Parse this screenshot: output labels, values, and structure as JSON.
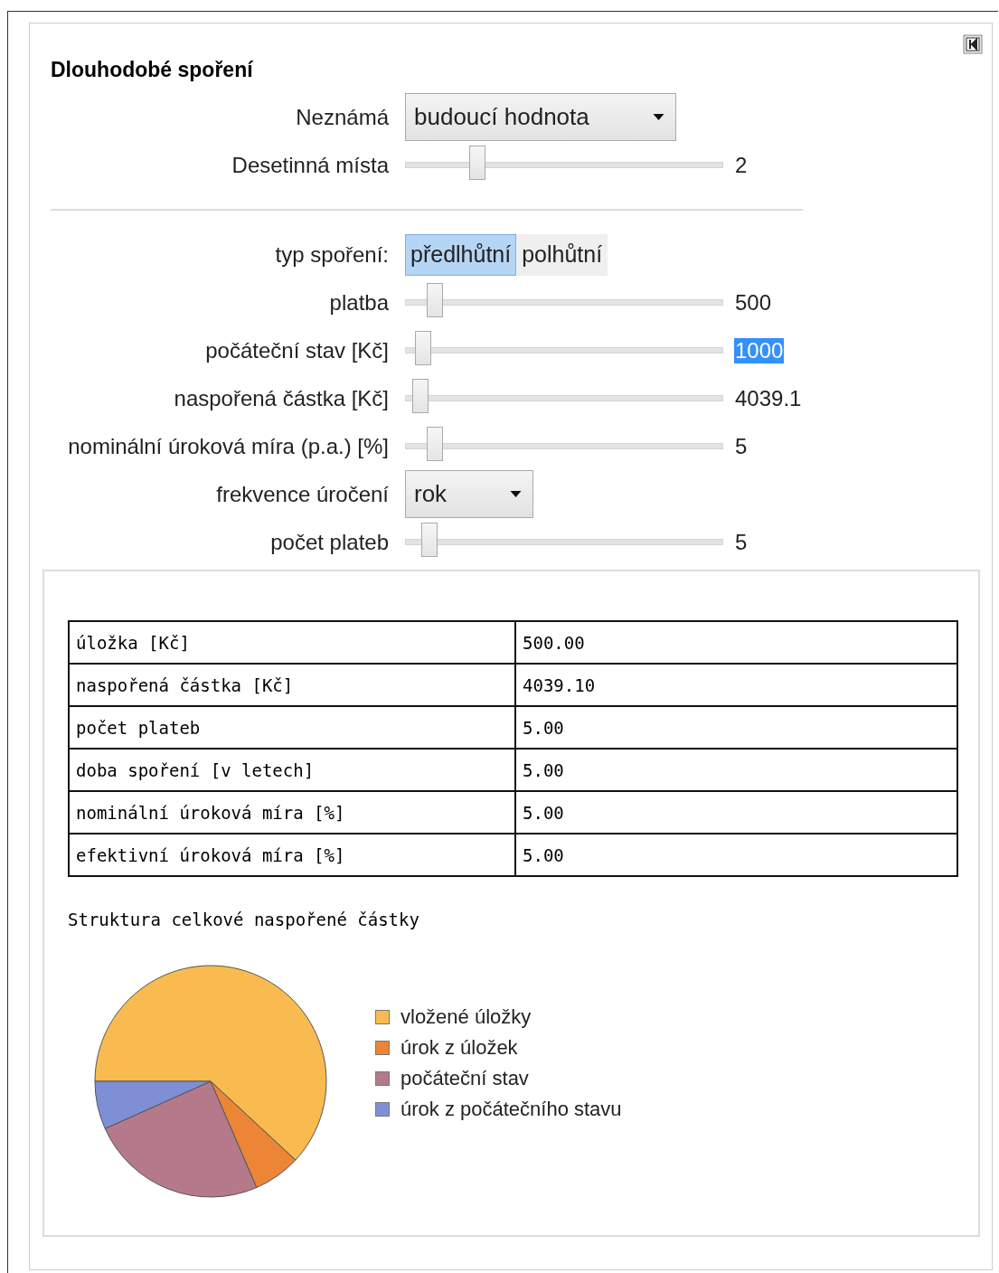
{
  "title": "Dlouhodobé spoření",
  "settings": [
    {
      "kind": "popup",
      "label": "Neznámá",
      "value": "budoucí hodnota"
    },
    {
      "kind": "slider",
      "label": "Desetinná místa",
      "level": 0.21,
      "reading": "2",
      "highlighted": false
    }
  ],
  "controls": [
    {
      "kind": "setter",
      "label": "typ spoření:",
      "options": [
        {
          "label": "předlhůtní",
          "selected": true
        },
        {
          "label": "polhůtní",
          "selected": false
        }
      ]
    },
    {
      "kind": "slider",
      "label": "platba",
      "level": 0.07,
      "reading": "500",
      "highlighted": false
    },
    {
      "kind": "slider",
      "label": "počáteční stav [Kč]",
      "level": 0.03,
      "reading": "1000",
      "highlighted": true
    },
    {
      "kind": "slider",
      "label": "naspořená částka [Kč]",
      "level": 0.02,
      "reading": "4039.1",
      "highlighted": false
    },
    {
      "kind": "slider",
      "label": "nominální úroková míra (p.a.) [%]",
      "level": 0.07,
      "reading": "5",
      "highlighted": false
    },
    {
      "kind": "popup",
      "label": "frekvence úročení",
      "value": "rok"
    },
    {
      "kind": "slider",
      "label": "počet plateb",
      "level": 0.05,
      "reading": "5",
      "highlighted": false
    }
  ],
  "results_table": {
    "rows": [
      {
        "label": "úložka [Kč]",
        "value": "500.00"
      },
      {
        "label": "naspořená částka [Kč]",
        "value": "4039.10"
      },
      {
        "label": "počet plateb",
        "value": "5.00"
      },
      {
        "label": "doba spoření [v letech]",
        "value": "5.00"
      },
      {
        "label": "nominální úroková míra [%]",
        "value": "5.00"
      },
      {
        "label": "efektivní úroková míra [%]",
        "value": "5.00"
      }
    ]
  },
  "chart": {
    "title": "Struktura celkové naspořené částky",
    "legend": [
      {
        "label": "vložené úložky",
        "color": "#f9bb4f"
      },
      {
        "label": "úrok z úložek",
        "color": "#ec8535"
      },
      {
        "label": "počáteční stav",
        "color": "#b47a89"
      },
      {
        "label": "úrok z počátečního stavu",
        "color": "#7f8fd5"
      }
    ]
  }
}
